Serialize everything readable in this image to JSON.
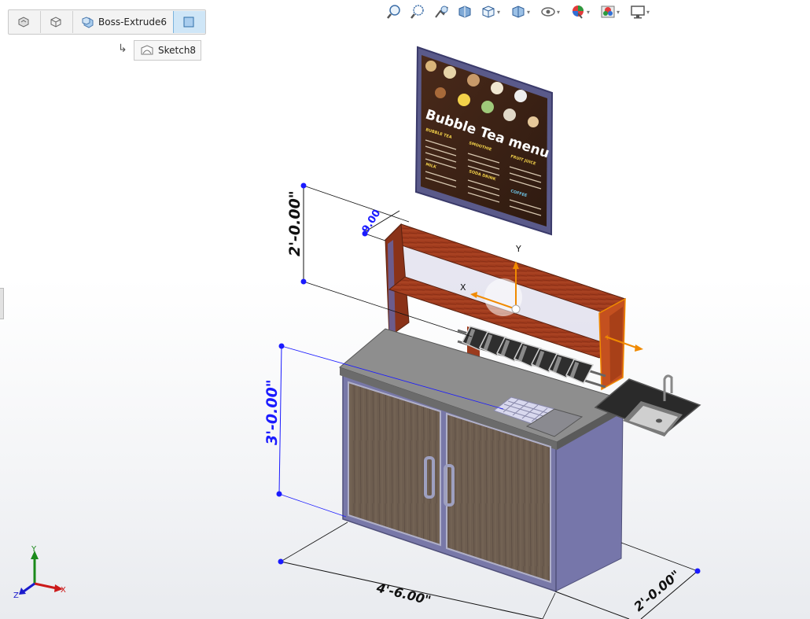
{
  "breadcrumb": {
    "items": [
      {
        "label": "",
        "icon": "part-icon"
      },
      {
        "label": "",
        "icon": "body-icon"
      },
      {
        "label": "Boss-Extrude6",
        "icon": "feature-icon"
      },
      {
        "label": "",
        "icon": "face-icon",
        "active": true
      }
    ],
    "sub": {
      "label": "Sketch8",
      "icon": "sketch-icon"
    }
  },
  "heads_up_toolbar": [
    "zoom-to-fit-icon",
    "zoom-to-area-icon",
    "previous-view-icon",
    "section-view-icon",
    "view-orientation-icon",
    "display-style-icon",
    "hide-show-items-icon",
    "edit-appearance-icon",
    "apply-scene-icon",
    "view-settings-icon"
  ],
  "dimensions": {
    "upper_height": "2'-0.00\"",
    "shelf_depth": "9.00",
    "counter_height": "3'-0.00\"",
    "width": "4'-6.00\"",
    "depth": "2'-0.00\""
  },
  "menu_board": {
    "title": "Bubble Tea menu",
    "sections": [
      "BUBBLE TEA",
      "SMOOTHIE",
      "FRUIT JUICE",
      "MILK",
      "SODA DRINK",
      "COFFEE"
    ]
  },
  "axes": {
    "x": "X",
    "y": "Y",
    "z": "Z"
  },
  "triad": {
    "x": "X",
    "y": "Y"
  },
  "colors": {
    "wood": "#9b3a1d",
    "door": "#6e5e50",
    "cabinet": "#7878a8",
    "dim_blue": "#1a1aff",
    "accent": "#f08a00"
  }
}
